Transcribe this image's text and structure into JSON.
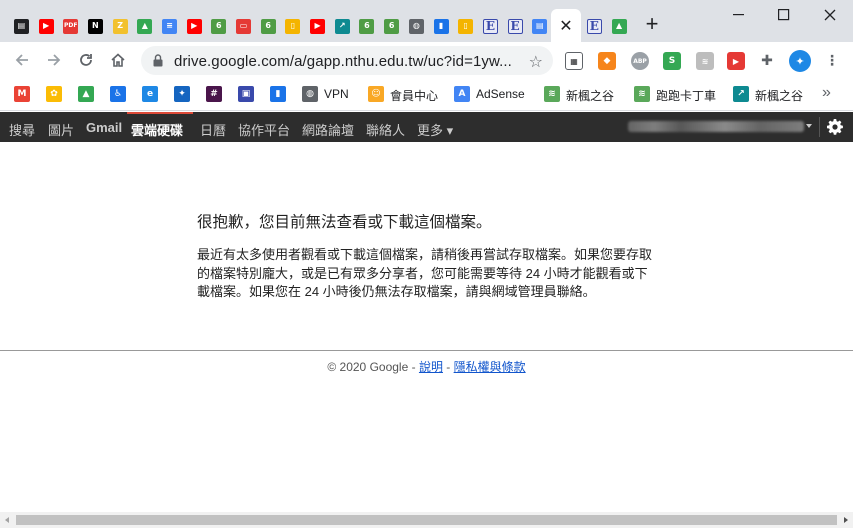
{
  "browser": {
    "active_tab_close": "✕",
    "new_tab": "+",
    "url": "drive.google.com/a/gapp.nthu.edu.tw/uc?id=1yw...",
    "tab_favicons": [
      {
        "icon": "docs-icon",
        "bg": "#202124",
        "glyph": "▤"
      },
      {
        "icon": "youtube-icon",
        "bg": "#ff0000",
        "glyph": "▶"
      },
      {
        "icon": "pdf-icon",
        "bg": "#e53935",
        "glyph": "PDF"
      },
      {
        "icon": "netflix-icon",
        "bg": "#000000",
        "glyph": "N"
      },
      {
        "icon": "zotero-icon",
        "bg": "#f2c12e",
        "glyph": "Z"
      },
      {
        "icon": "google-drive-icon",
        "bg": "#34a853",
        "glyph": "▲"
      },
      {
        "icon": "google-docs-icon",
        "bg": "#4285f4",
        "glyph": "≡"
      },
      {
        "icon": "youtube-icon",
        "bg": "#ff0000",
        "glyph": "▶"
      },
      {
        "icon": "overleaf-icon",
        "bg": "#4f9c45",
        "glyph": "6"
      },
      {
        "icon": "red-app-icon",
        "bg": "#e53935",
        "glyph": "▭"
      },
      {
        "icon": "overleaf-icon",
        "bg": "#4f9c45",
        "glyph": "6"
      },
      {
        "icon": "notes-icon",
        "bg": "#f4b400",
        "glyph": "▯"
      },
      {
        "icon": "youtube-icon",
        "bg": "#ff0000",
        "glyph": "▶"
      },
      {
        "icon": "teal-app-icon",
        "bg": "#0e8a91",
        "glyph": "↗"
      },
      {
        "icon": "overleaf-icon",
        "bg": "#4f9c45",
        "glyph": "6"
      },
      {
        "icon": "overleaf-icon",
        "bg": "#4f9c45",
        "glyph": "6"
      },
      {
        "icon": "globe-icon",
        "bg": "#5f6368",
        "glyph": "◍"
      },
      {
        "icon": "blue-book-icon",
        "bg": "#1a73e8",
        "glyph": "▮"
      },
      {
        "icon": "notes-icon",
        "bg": "#f4b400",
        "glyph": "▯"
      },
      {
        "icon": "e-letter-icon",
        "bg": "#e8eaf6",
        "glyph": "E"
      },
      {
        "icon": "e-letter-icon",
        "bg": "#e8eaf6",
        "glyph": "E"
      },
      {
        "icon": "blue-doc-icon",
        "bg": "#4285f4",
        "glyph": "▤"
      }
    ],
    "after_active_favicons": [
      {
        "icon": "e-letter-icon",
        "bg": "#e8eaf6",
        "glyph": "E"
      },
      {
        "icon": "google-drive-icon",
        "bg": "#34a853",
        "glyph": "▲"
      }
    ]
  },
  "bookmarks": [
    {
      "icon": "gmail-icon",
      "bg": "#ea4335",
      "glyph": "M",
      "label": ""
    },
    {
      "icon": "google-photos-icon",
      "bg": "#fbbc05",
      "glyph": "✿",
      "label": ""
    },
    {
      "icon": "google-drive-icon",
      "bg": "#34a853",
      "glyph": "▲",
      "label": ""
    },
    {
      "icon": "accessibility-icon",
      "bg": "#1a73e8",
      "glyph": "♿",
      "label": ""
    },
    {
      "icon": "edge-icon",
      "bg": "#1e88e5",
      "glyph": "e",
      "label": ""
    },
    {
      "icon": "maple-leaf-icon",
      "bg": "#1565c0",
      "glyph": "✦",
      "label": ""
    },
    {
      "icon": "slack-icon",
      "bg": "#4a154b",
      "glyph": "#",
      "label": ""
    },
    {
      "icon": "chip-icon",
      "bg": "#3949ab",
      "glyph": "▣",
      "label": ""
    },
    {
      "icon": "blue-book-icon",
      "bg": "#1a73e8",
      "glyph": "▮",
      "label": ""
    },
    {
      "icon": "globe-icon",
      "bg": "#5f6368",
      "glyph": "◍",
      "label": "VPN"
    },
    {
      "icon": "member-icon",
      "bg": "#f9a825",
      "glyph": "☺",
      "label": "會員中心"
    },
    {
      "icon": "adsense-icon",
      "bg": "#4285f4",
      "glyph": "A",
      "label": "AdSense"
    },
    {
      "icon": "ticket-icon",
      "bg": "#5aa85a",
      "glyph": "≋",
      "label": "新楓之谷"
    },
    {
      "icon": "ticket-icon",
      "bg": "#5aa85a",
      "glyph": "≋",
      "label": "跑跑卡丁車"
    },
    {
      "icon": "teal-app-icon",
      "bg": "#0e8a91",
      "glyph": "↗",
      "label": "新楓之谷"
    }
  ],
  "bookmarks_more": "»",
  "gbar": {
    "items": [
      "搜尋",
      "圖片",
      "Gmail",
      "雲端硬碟",
      "日曆",
      "協作平台",
      "網路論壇",
      "聯絡人",
      "更多 ▾"
    ],
    "active_index": 3
  },
  "content": {
    "title": "很抱歉，您目前無法查看或下載這個檔案。",
    "body": "最近有太多使用者觀看或下載這個檔案，請稍後再嘗試存取檔案。如果您要存取的檔案特別龐大，或是已有眾多分享者，您可能需要等待 24 小時才能觀看或下載檔案。如果您在 24 小時後仍無法存取檔案，請與網域管理員聯絡。",
    "footer_copyright": "© 2020 Google - ",
    "footer_help": "說明",
    "footer_sep": " - ",
    "footer_privacy": "隱私權與條款"
  }
}
